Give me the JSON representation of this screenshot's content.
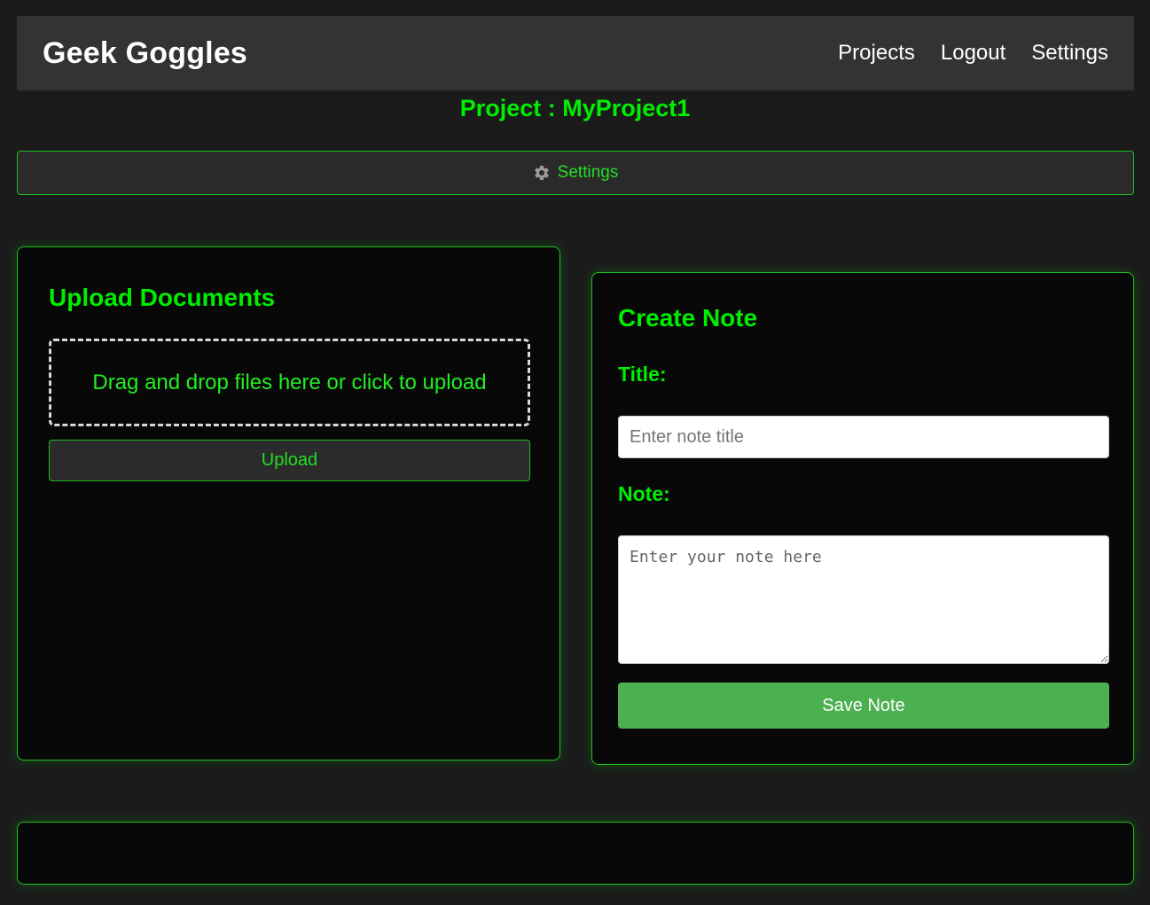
{
  "app": {
    "brand": "Geek Goggles"
  },
  "nav": {
    "items": [
      "Projects",
      "Logout",
      "Settings"
    ]
  },
  "project": {
    "heading": "Project : MyProject1"
  },
  "settings_bar": {
    "icon": "gear-icon",
    "label": "Settings"
  },
  "upload": {
    "title": "Upload Documents",
    "dropzone_text": "Drag and drop files here or click to upload",
    "button_label": "Upload"
  },
  "note": {
    "title": "Create Note",
    "title_label": "Title:",
    "title_placeholder": "Enter note title",
    "title_value": "",
    "note_label": "Note:",
    "note_placeholder": "Enter your note here",
    "note_value": "",
    "save_label": "Save Note"
  },
  "colors": {
    "background": "#1b1b1b",
    "navbar": "#333333",
    "accent_green": "#00ee00",
    "border_green": "#1fbf1f",
    "save_button": "#4caf50"
  }
}
